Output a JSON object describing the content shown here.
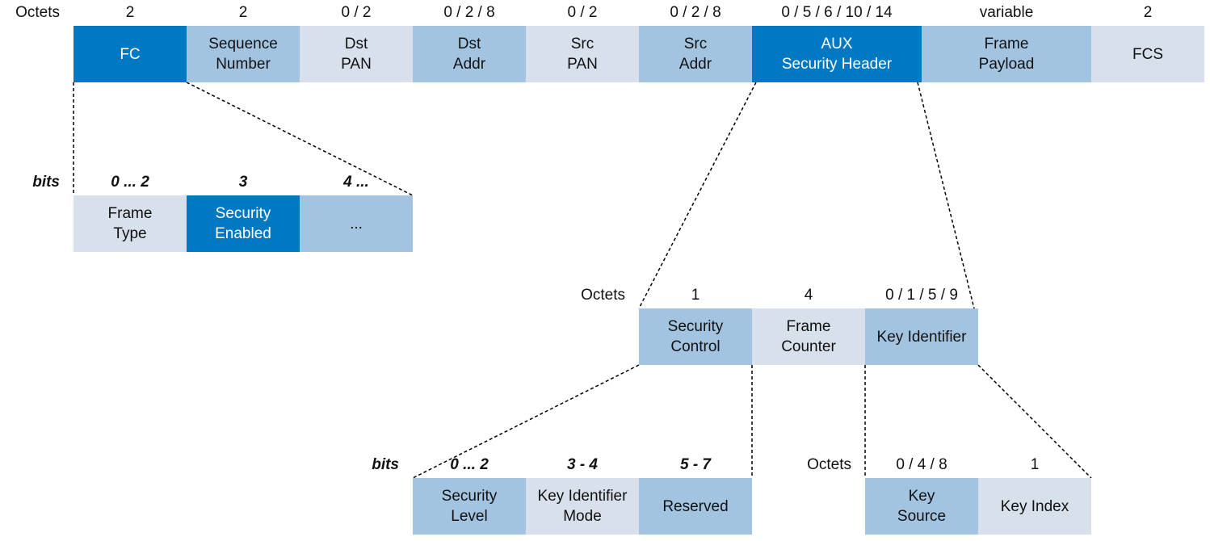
{
  "colors": {
    "dark": "#0079c2",
    "medium": "#a2c4e1",
    "light": "#d8e0eb"
  },
  "frame": {
    "row_label": "Octets",
    "fields": [
      {
        "size": "2",
        "label": "FC",
        "shade": "dark"
      },
      {
        "size": "2",
        "label": "Sequence\nNumber",
        "shade": "medium"
      },
      {
        "size": "0 / 2",
        "label": "Dst\nPAN",
        "shade": "light"
      },
      {
        "size": "0 / 2 / 8",
        "label": "Dst\nAddr",
        "shade": "medium"
      },
      {
        "size": "0 / 2",
        "label": "Src\nPAN",
        "shade": "light"
      },
      {
        "size": "0 / 2 / 8",
        "label": "Src\nAddr",
        "shade": "medium"
      },
      {
        "size": "0 / 5 / 6 / 10 / 14",
        "label": "AUX\nSecurity Header",
        "shade": "dark"
      },
      {
        "size": "variable",
        "label": "Frame\nPayload",
        "shade": "medium"
      },
      {
        "size": "2",
        "label": "FCS",
        "shade": "light"
      }
    ]
  },
  "fc": {
    "row_label": "bits",
    "fields": [
      {
        "size": "0 ... 2",
        "label": "Frame\nType",
        "shade": "light"
      },
      {
        "size": "3",
        "label": "Security\nEnabled",
        "shade": "dark"
      },
      {
        "size": "4 ...",
        "label": "...",
        "shade": "medium"
      }
    ]
  },
  "aux": {
    "row_label": "Octets",
    "fields": [
      {
        "size": "1",
        "label": "Security\nControl",
        "shade": "medium"
      },
      {
        "size": "4",
        "label": "Frame\nCounter",
        "shade": "light"
      },
      {
        "size": "0 / 1 / 5 / 9",
        "label": "Key Identifier",
        "shade": "medium"
      }
    ]
  },
  "security_control": {
    "row_label": "bits",
    "fields": [
      {
        "size": "0 ... 2",
        "label": "Security\nLevel",
        "shade": "medium"
      },
      {
        "size": "3 - 4",
        "label": "Key Identifier\nMode",
        "shade": "light"
      },
      {
        "size": "5 - 7",
        "label": "Reserved",
        "shade": "medium"
      }
    ]
  },
  "key_identifier": {
    "row_label": "Octets",
    "fields": [
      {
        "size": "0 / 4 / 8",
        "label": "Key\nSource",
        "shade": "medium"
      },
      {
        "size": "1",
        "label": "Key Index",
        "shade": "light"
      }
    ]
  }
}
